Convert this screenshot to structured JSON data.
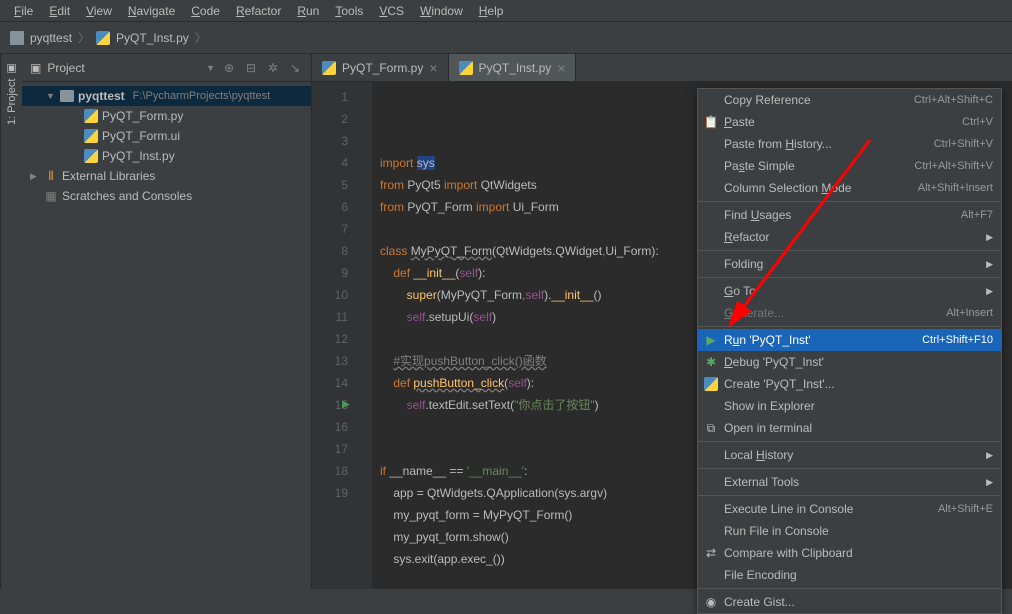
{
  "menubar": [
    "File",
    "Edit",
    "View",
    "Navigate",
    "Code",
    "Refactor",
    "Run",
    "Tools",
    "VCS",
    "Window",
    "Help"
  ],
  "breadcrumb": {
    "project": "pyqttest",
    "file": "PyQT_Inst.py"
  },
  "project_panel": {
    "title": "Project",
    "root": {
      "name": "pyqttest",
      "path": "F:\\PycharmProjects\\pyqttest"
    },
    "files": [
      "PyQT_Form.py",
      "PyQT_Form.ui",
      "PyQT_Inst.py"
    ],
    "ext_libs": "External Libraries",
    "scratches": "Scratches and Consoles"
  },
  "tabs": [
    {
      "name": "PyQT_Form.py",
      "active": false
    },
    {
      "name": "PyQT_Inst.py",
      "active": true
    }
  ],
  "code_lines": [
    {
      "n": 1,
      "html": "<span class='kw'>import</span> <span class='box'>sys</span>"
    },
    {
      "n": 2,
      "html": "<span class='kw'>from</span> PyQt5 <span class='kw'>import</span> QtWidgets"
    },
    {
      "n": 3,
      "html": "<span class='kw'>from</span> PyQT_Form <span class='kw'>import</span> Ui_Form"
    },
    {
      "n": 4,
      "html": ""
    },
    {
      "n": 5,
      "html": "<span class='kw'>class</span> <span class='warn'>MyPyQT_Form</span>(QtWidgets.QWidget<span class='comment'>,</span>Ui_Form):"
    },
    {
      "n": 6,
      "html": "    <span class='kw'>def</span> <span class='fn'>__init__</span>(<span class='self'>self</span>):"
    },
    {
      "n": 7,
      "html": "        <span class='fn'>super</span>(MyPyQT_Form<span class='comment'>,</span><span class='self'>self</span>).<span class='fn'>__init__</span>()"
    },
    {
      "n": 8,
      "html": "        <span class='self'>self</span>.setupUi(<span class='self'>self</span>)"
    },
    {
      "n": 9,
      "html": ""
    },
    {
      "n": 10,
      "html": "    <span class='comment warn'>#实现pushButton_click()函数</span>"
    },
    {
      "n": 11,
      "html": "    <span class='kw'>def</span> <span class='fn warn'>pushButton_click</span>(<span class='self'>self</span>):"
    },
    {
      "n": 12,
      "html": "        <span class='self'>self</span>.textEdit.setText(<span class='str'>\"你点击了按钮\"</span>)"
    },
    {
      "n": 13,
      "html": ""
    },
    {
      "n": 14,
      "html": ""
    },
    {
      "n": 15,
      "html": "<span class='kw'>if</span> __name__ == <span class='str'>'__main__'</span>:"
    },
    {
      "n": 16,
      "html": "    app = QtWidgets.QApplication(sys.argv)"
    },
    {
      "n": 17,
      "html": "    my_pyqt_form = MyPyQT_Form()"
    },
    {
      "n": 18,
      "html": "    my_pyqt_form.show()"
    },
    {
      "n": 19,
      "html": "    sys.exit(app.exec_())"
    }
  ],
  "context_menu": [
    {
      "label": "Copy Reference",
      "shortcut": "Ctrl+Alt+Shift+C"
    },
    {
      "label": "Paste",
      "shortcut": "Ctrl+V",
      "icon": "paste"
    },
    {
      "label": "Paste from History...",
      "shortcut": "Ctrl+Shift+V"
    },
    {
      "label": "Paste Simple",
      "shortcut": "Ctrl+Alt+Shift+V"
    },
    {
      "label": "Column Selection Mode",
      "shortcut": "Alt+Shift+Insert"
    },
    {
      "sep": true
    },
    {
      "label": "Find Usages",
      "shortcut": "Alt+F7"
    },
    {
      "label": "Refactor",
      "submenu": true
    },
    {
      "sep": true
    },
    {
      "label": "Folding",
      "submenu": true
    },
    {
      "sep": true
    },
    {
      "label": "Go To",
      "submenu": true
    },
    {
      "label": "Generate...",
      "shortcut": "Alt+Insert",
      "disabled": true
    },
    {
      "sep": true
    },
    {
      "label": "Run 'PyQT_Inst'",
      "shortcut": "Ctrl+Shift+F10",
      "icon": "run",
      "highlighted": true
    },
    {
      "label": "Debug 'PyQT_Inst'",
      "icon": "debug"
    },
    {
      "label": "Create 'PyQT_Inst'...",
      "icon": "python"
    },
    {
      "label": "Show in Explorer"
    },
    {
      "label": "Open in terminal",
      "icon": "terminal"
    },
    {
      "sep": true
    },
    {
      "label": "Local History",
      "submenu": true
    },
    {
      "sep": true
    },
    {
      "label": "External Tools",
      "submenu": true
    },
    {
      "sep": true
    },
    {
      "label": "Execute Line in Console",
      "shortcut": "Alt+Shift+E"
    },
    {
      "label": "Run File in Console"
    },
    {
      "label": "Compare with Clipboard",
      "icon": "compare"
    },
    {
      "label": "File Encoding"
    },
    {
      "sep": true
    },
    {
      "label": "Create Gist...",
      "icon": "github"
    }
  ]
}
